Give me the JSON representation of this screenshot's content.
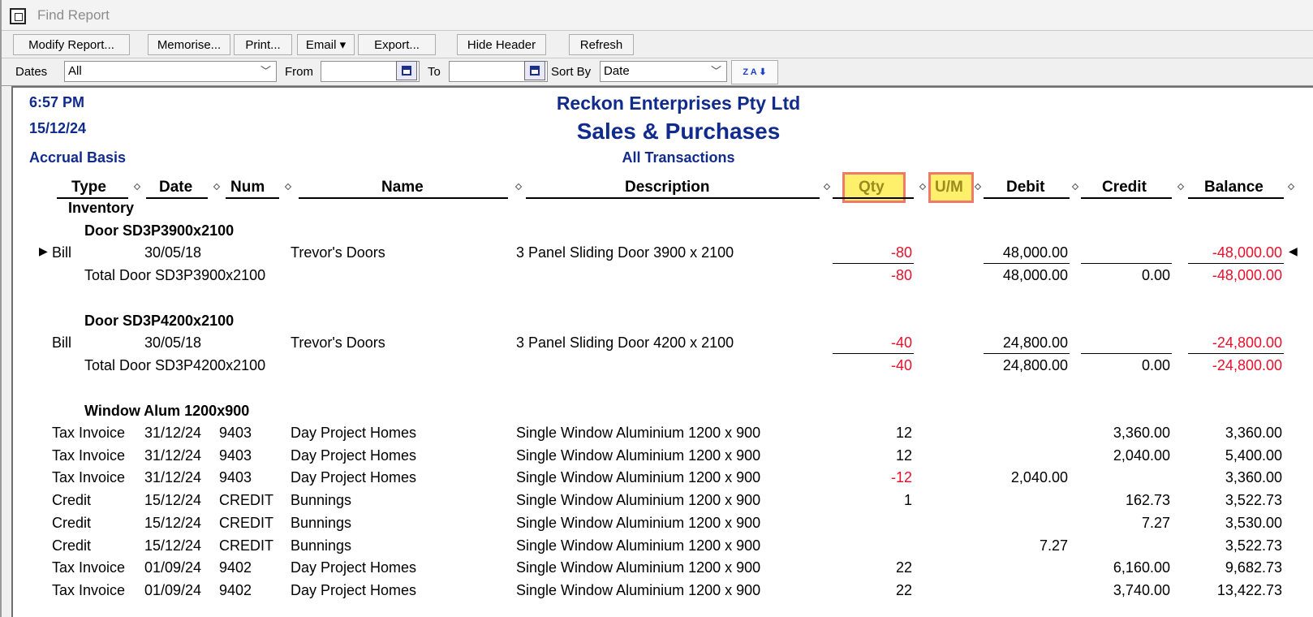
{
  "window": {
    "title": "Find Report"
  },
  "toolbar": {
    "buttons": [
      {
        "label": "Modify Report..."
      },
      {
        "label": "Memorise..."
      },
      {
        "label": "Print..."
      },
      {
        "label": "Email ▾"
      },
      {
        "label": "Export..."
      },
      {
        "label": "Hide Header"
      },
      {
        "label": "Refresh"
      }
    ]
  },
  "filters": {
    "dates_label": "Dates",
    "dates_value": "All",
    "from_label": "From",
    "from_value": "",
    "to_label": "To",
    "to_value": "",
    "sortby_label": "Sort By",
    "sortby_value": "Date",
    "sort_icon_text": "Z A ⬇"
  },
  "report": {
    "time": "6:57 PM",
    "date": "15/12/24",
    "basis": "Accrual Basis",
    "company": "Reckon Enterprises Pty Ltd",
    "title": "Sales & Purchases",
    "subtitle": "All Transactions",
    "columns": {
      "type": "Type",
      "date": "Date",
      "num": "Num",
      "name": "Name",
      "description": "Description",
      "qty": "Qty",
      "um": "U/M",
      "debit": "Debit",
      "credit": "Credit",
      "balance": "Balance"
    },
    "group": "Inventory",
    "sections": [
      {
        "title": "Door SD3P3900x2100",
        "rows": [
          {
            "type": "Bill",
            "date": "30/05/18",
            "num": "",
            "name": "Trevor's Doors",
            "description": "3 Panel Sliding Door 3900 x 2100",
            "qty": "-80",
            "debit": "48,000.00",
            "credit": "",
            "balance": "-48,000.00"
          }
        ],
        "total": {
          "label": "Total Door SD3P3900x2100",
          "qty": "-80",
          "debit": "48,000.00",
          "credit": "0.00",
          "balance": "-48,000.00"
        }
      },
      {
        "title": "Door SD3P4200x2100",
        "rows": [
          {
            "type": "Bill",
            "date": "30/05/18",
            "num": "",
            "name": "Trevor's Doors",
            "description": "3 Panel Sliding Door 4200 x 2100",
            "qty": "-40",
            "debit": "24,800.00",
            "credit": "",
            "balance": "-24,800.00"
          }
        ],
        "total": {
          "label": "Total Door SD3P4200x2100",
          "qty": "-40",
          "debit": "24,800.00",
          "credit": "0.00",
          "balance": "-24,800.00"
        }
      },
      {
        "title": "Window Alum 1200x900",
        "rows": [
          {
            "type": "Tax Invoice",
            "date": "31/12/24",
            "num": "9403",
            "name": "Day Project Homes",
            "description": "Single Window Aluminium 1200 x 900",
            "qty": "12",
            "debit": "",
            "credit": "3,360.00",
            "balance": "3,360.00"
          },
          {
            "type": "Tax Invoice",
            "date": "31/12/24",
            "num": "9403",
            "name": "Day Project Homes",
            "description": "Single Window Aluminium 1200 x 900",
            "qty": "12",
            "debit": "",
            "credit": "2,040.00",
            "balance": "5,400.00"
          },
          {
            "type": "Tax Invoice",
            "date": "31/12/24",
            "num": "9403",
            "name": "Day Project Homes",
            "description": "Single Window Aluminium 1200 x 900",
            "qty": "-12",
            "debit": "2,040.00",
            "credit": "",
            "balance": "3,360.00"
          },
          {
            "type": "Credit",
            "date": "15/12/24",
            "num": "CREDIT",
            "name": "Bunnings",
            "description": "Single Window Aluminium 1200 x 900",
            "qty": "1",
            "debit": "",
            "credit": "162.73",
            "balance": "3,522.73"
          },
          {
            "type": "Credit",
            "date": "15/12/24",
            "num": "CREDIT",
            "name": "Bunnings",
            "description": "Single Window Aluminium 1200 x 900",
            "qty": "",
            "debit": "",
            "credit": "7.27",
            "balance": "3,530.00"
          },
          {
            "type": "Credit",
            "date": "15/12/24",
            "num": "CREDIT",
            "name": "Bunnings",
            "description": "Single Window Aluminium 1200 x 900",
            "qty": "",
            "debit": "7.27",
            "credit": "",
            "balance": "3,522.73"
          },
          {
            "type": "Tax Invoice",
            "date": "01/09/24",
            "num": "9402",
            "name": "Day Project Homes",
            "description": "Single Window Aluminium 1200 x 900",
            "qty": "22",
            "debit": "",
            "credit": "6,160.00",
            "balance": "9,682.73"
          },
          {
            "type": "Tax Invoice",
            "date": "01/09/24",
            "num": "9402",
            "name": "Day Project Homes",
            "description": "Single Window Aluminium 1200 x 900",
            "qty": "22",
            "debit": "",
            "credit": "3,740.00",
            "balance": "13,422.73"
          }
        ]
      }
    ]
  }
}
